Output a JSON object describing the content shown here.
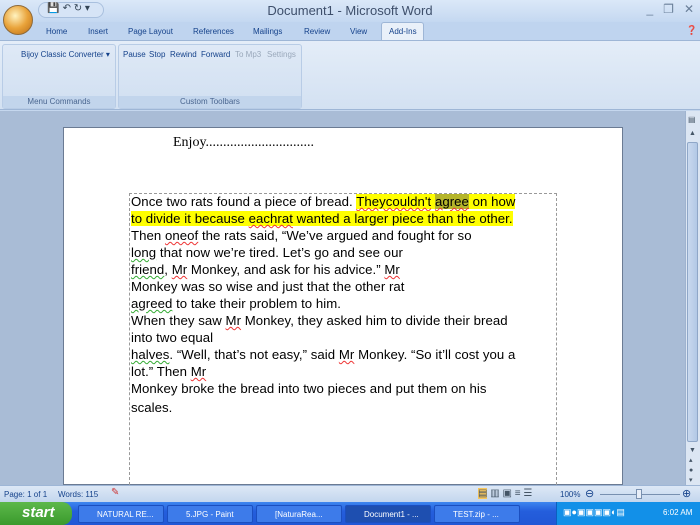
{
  "window": {
    "title": "Document1 - Microsoft Word"
  },
  "tabs": [
    "Home",
    "Insert",
    "Page Layout",
    "References",
    "Mailings",
    "Review",
    "View",
    "Add-Ins"
  ],
  "active_tab": "Add-Ins",
  "ribbon": {
    "groups": [
      {
        "label": "Menu Commands",
        "buttons": [
          "Bijoy Classic Converter ▾"
        ]
      },
      {
        "label": "Custom Toolbars",
        "buttons": [
          "Pause",
          "Stop",
          "Rewind",
          "Forward",
          "To Mp3",
          "Settings"
        ]
      }
    ]
  },
  "document": {
    "heading": "Enjoy...............................",
    "lines": [
      [
        "Once two rats found a piece of bread. ",
        "Theycouldn't",
        " ",
        "agree",
        " on how"
      ],
      [
        "to divide it because ",
        "eachrat",
        " wanted a larger piece than the other."
      ],
      [
        "Then ",
        "oneof",
        " the rats said, “We’ve argued and fought for so"
      ],
      [
        "long",
        " that now we’re tired. Let’s go and see our"
      ],
      [
        "friend",
        ", ",
        "Mr",
        " Monkey, and ask for his advice.” ",
        "Mr"
      ],
      [
        "Monkey was so wise and just that the other rat"
      ],
      [
        "agreed",
        " to take their problem to him."
      ],
      [
        "When they saw ",
        "Mr",
        " Monkey, they asked him to divide their bread"
      ],
      [
        "into two equal"
      ],
      [
        "halves",
        ". “Well, that’s not easy,” said ",
        "Mr",
        " Monkey. “So it’ll cost you a"
      ],
      [
        "lot.” Then ",
        "Mr"
      ],
      [
        "Monkey broke the bread into two pieces and put them on his"
      ],
      [
        "scales."
      ]
    ]
  },
  "statusbar": {
    "page": "Page: 1 of 1",
    "words": "Words: 115",
    "zoom": "100%"
  },
  "taskbar": {
    "start": "start",
    "items": [
      "NATURAL RE...",
      "5.JPG - Paint",
      "[NaturaRea...",
      "Document1 - ...",
      "TEST.zip - ..."
    ],
    "active_index": 3,
    "clock": "6:02 AM"
  },
  "colors": {
    "highlight": "#ffff00",
    "selection": "#b5b52a",
    "taskbar": "#245edc",
    "start": "#3a9a2c"
  }
}
